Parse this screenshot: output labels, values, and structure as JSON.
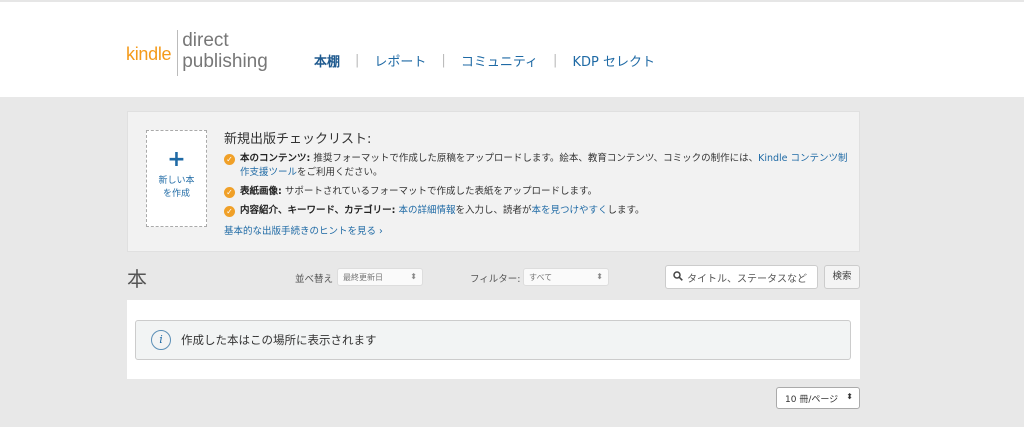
{
  "logo": {
    "kindle": "kindle",
    "line1": "direct",
    "line2": "publishing"
  },
  "nav": [
    {
      "label": "本棚",
      "active": true
    },
    {
      "label": "レポート"
    },
    {
      "label": "コミュニティ"
    },
    {
      "label": "KDP セレクト"
    }
  ],
  "nav_separator": "|",
  "new_book": {
    "icon": "plus-icon",
    "line1": "新しい本",
    "line2": "を作成"
  },
  "checklist": {
    "title": "新規出版チェックリスト:",
    "items": [
      {
        "bold": "本のコンテンツ:",
        "text1": " 推奨フォーマットで作成した原稿をアップロードします。絵本、教育コンテンツ、コミックの制作には、",
        "link": "Kindle コンテンツ制作支援ツール",
        "text2": "をご利用ください。"
      },
      {
        "bold": "表紙画像:",
        "text1": " サポートされているフォーマットで作成した表紙をアップロードします。"
      },
      {
        "bold": "内容紹介、キーワード、カテゴリー:",
        "text1": " ",
        "link": "本の詳細情報",
        "text2": "を入力し、読者が",
        "link2": "本を見つけやすく",
        "text3": "します。"
      }
    ],
    "hint": "基本的な出版手続きのヒントを見る ›",
    "check_icon": "check-circle-icon"
  },
  "books": {
    "title": "本",
    "sort_label": "並べ替え",
    "sort_value": "最終更新日",
    "filter_label": "フィルター:",
    "filter_value": "すべて",
    "search_placeholder": "タイトル、ステータスなど",
    "search_button": "検索",
    "empty_message": "作成した本はこの場所に表示されます",
    "per_page": "10 冊/ページ"
  },
  "icons": {
    "info": "info-icon",
    "search": "search-icon",
    "chevron": "updown-chevron-icon"
  },
  "colors": {
    "kindle_orange": "#f49a1a",
    "link_blue": "#1f6aa5",
    "check_orange": "#f0a028"
  }
}
